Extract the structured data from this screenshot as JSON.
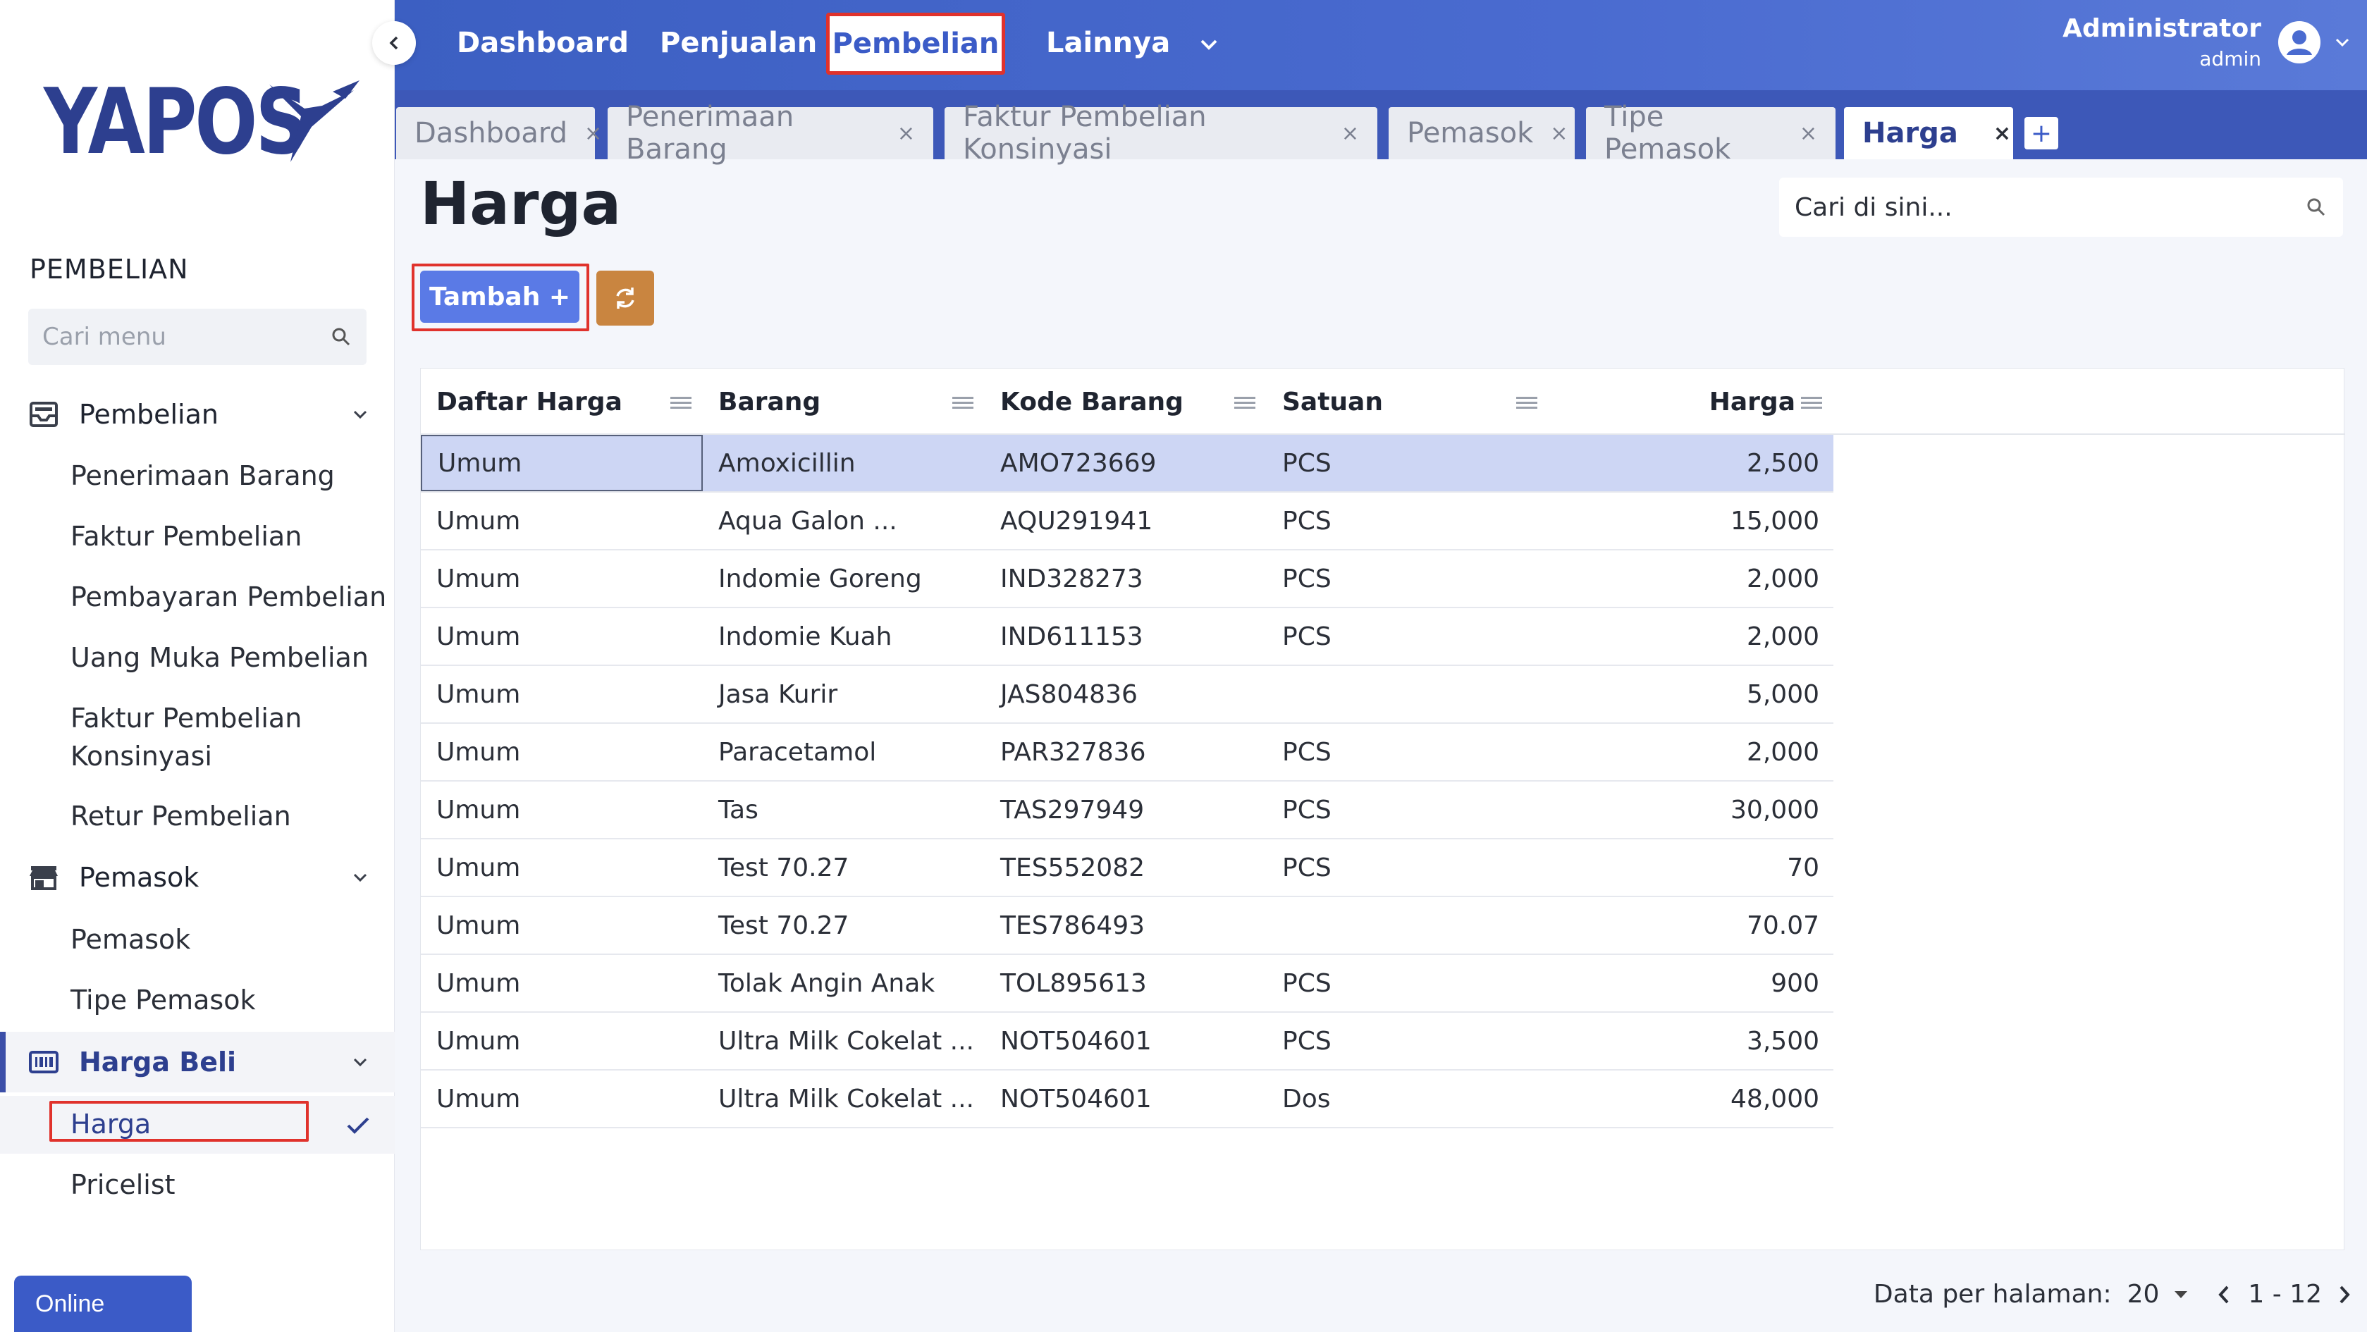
{
  "app": {
    "brand": "YAPOS",
    "status": "Online",
    "colors": {
      "primary": "#3b5bc7",
      "accent_orange": "#c98540",
      "highlight": "#e0322c",
      "selected_row": "#cdd6f4"
    }
  },
  "sidebar": {
    "section_title": "PEMBELIAN",
    "search_placeholder": "Cari menu",
    "groups": [
      {
        "label": "Pembelian",
        "icon": "inbox-tray-icon",
        "items": [
          "Penerimaan Barang",
          "Faktur Pembelian",
          "Pembayaran Pembelian",
          "Uang Muka Pembelian",
          "Faktur Pembelian Konsinyasi",
          "Retur Pembelian"
        ]
      },
      {
        "label": "Pemasok",
        "icon": "store-icon",
        "items": [
          "Pemasok",
          "Tipe Pemasok"
        ]
      },
      {
        "label": "Harga Beli",
        "icon": "barcode-icon",
        "items": [
          "Harga",
          "Pricelist"
        ],
        "active": true
      }
    ],
    "current_item": "Harga"
  },
  "topbar": {
    "nav": [
      "Dashboard",
      "Penjualan",
      "Pembelian",
      "Lainnya"
    ],
    "active_nav": "Pembelian",
    "user_name": "Administrator",
    "user_role": "admin"
  },
  "tabs": [
    {
      "label": "Dashboard",
      "close": "×"
    },
    {
      "label": "Penerimaan Barang",
      "close": "×"
    },
    {
      "label": "Faktur Pembelian Konsinyasi",
      "close": "×"
    },
    {
      "label": "Pemasok",
      "close": "×"
    },
    {
      "label": "Tipe Pemasok",
      "close": "×"
    },
    {
      "label": "Harga",
      "close": "×",
      "active": true
    }
  ],
  "tab_add": "+",
  "page": {
    "title": "Harga",
    "search_placeholder": "Cari di sini...",
    "add_button": "Tambah +"
  },
  "table": {
    "columns": [
      "Daftar Harga",
      "Barang",
      "Kode Barang",
      "Satuan",
      "Harga"
    ],
    "rows": [
      [
        "Umum",
        "Amoxicillin",
        "AMO723669",
        "PCS",
        "2,500"
      ],
      [
        "Umum",
        "Aqua Galon ...",
        "AQU291941",
        "PCS",
        "15,000"
      ],
      [
        "Umum",
        "Indomie Goreng",
        "IND328273",
        "PCS",
        "2,000"
      ],
      [
        "Umum",
        "Indomie Kuah",
        "IND611153",
        "PCS",
        "2,000"
      ],
      [
        "Umum",
        "Jasa Kurir",
        "JAS804836",
        "",
        "5,000"
      ],
      [
        "Umum",
        "Paracetamol",
        "PAR327836",
        "PCS",
        "2,000"
      ],
      [
        "Umum",
        "Tas",
        "TAS297949",
        "PCS",
        "30,000"
      ],
      [
        "Umum",
        "Test 70.27",
        "TES552082",
        "PCS",
        "70"
      ],
      [
        "Umum",
        "Test 70.27",
        "TES786493",
        "",
        "70.07"
      ],
      [
        "Umum",
        "Tolak Angin Anak",
        "TOL895613",
        "PCS",
        "900"
      ],
      [
        "Umum",
        "Ultra Milk Cokelat ...",
        "NOT504601",
        "PCS",
        "3,500"
      ],
      [
        "Umum",
        "Ultra Milk Cokelat ...",
        "NOT504601",
        "Dos",
        "48,000"
      ]
    ]
  },
  "pager": {
    "label": "Data per halaman:",
    "per_page": "20",
    "range": "1 - 12"
  }
}
